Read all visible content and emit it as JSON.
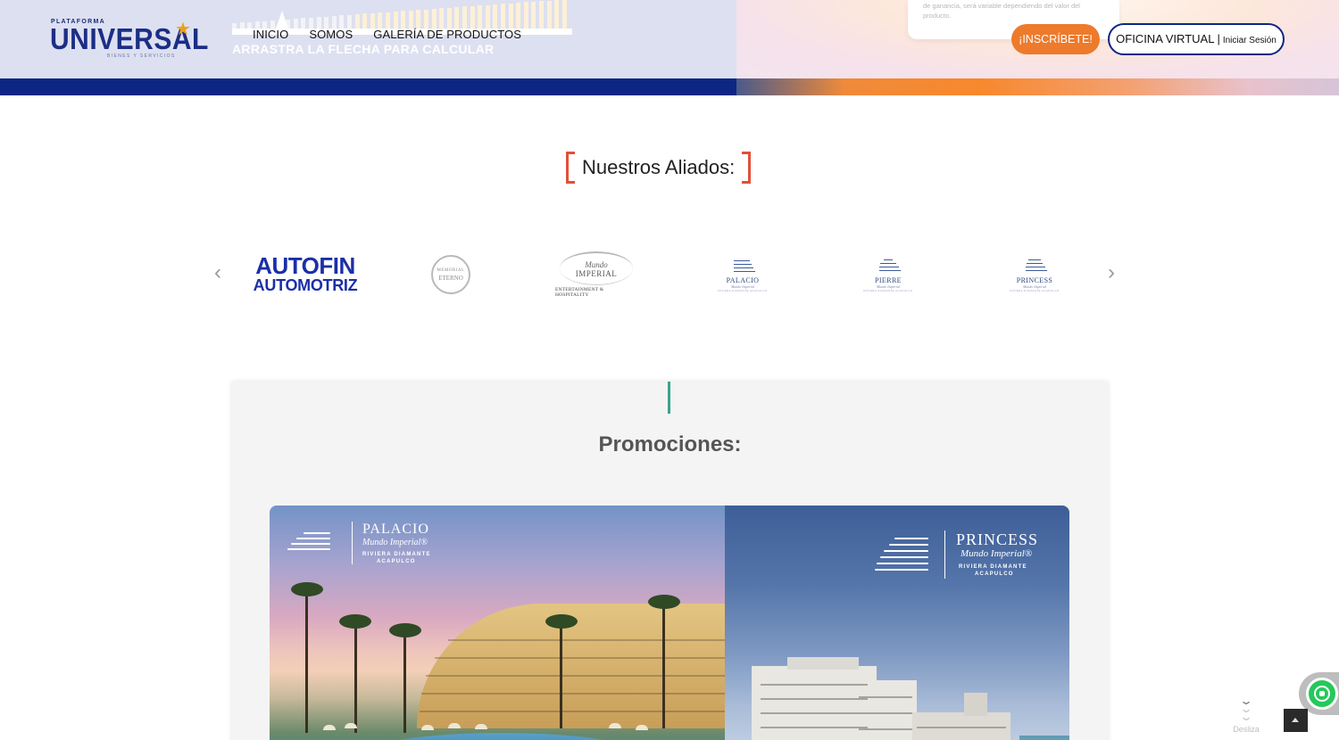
{
  "header": {
    "logo": {
      "top": "PLATAFORMA",
      "main": "UNIVERSAL",
      "sub": "BIENES Y SERVICIOS"
    },
    "nav": [
      "INICIO",
      "SOMOS",
      "GALERÍA DE PRODUCTOS"
    ],
    "calculator_hint": "ARRASTRA LA FLECHA PARA CALCULAR",
    "info_card_text": "de ganancia, será variable dependiendo del valor del producto.",
    "signup_label": "¡INSCRÍBETE!",
    "office_label": "OFICINA VIRTUAL",
    "office_separator": "|",
    "office_login": "Iniciar Sesión",
    "colors": {
      "navy": "#0d2683",
      "orange": "#ee7a2c"
    }
  },
  "allies": {
    "title": "Nuestros Aliados:",
    "prev_glyph": "‹",
    "next_glyph": "›",
    "items": [
      {
        "line1": "AUTOFIN",
        "line2": "AUTOMOTRIZ"
      },
      {
        "line1": "MEMORIAL",
        "line2": "ETERNO"
      },
      {
        "script": "Mundo",
        "name": "IMPERIAL",
        "tagline": "ENTERTAINMENT & HOSPITALITY"
      },
      {
        "name": "PALACIO",
        "script": "Mundo Imperial",
        "tagline": "RIVIERA DIAMANTE ACAPULCO"
      },
      {
        "name": "PIERRE",
        "script": "Mundo Imperial",
        "tagline": "RIVIERA DIAMANTE ACAPULCO"
      },
      {
        "name": "PRINCESS",
        "script": "Mundo Imperial",
        "tagline": "RIVIERA DIAMANTE ACAPULCO"
      }
    ]
  },
  "promotions": {
    "title": "Promociones:",
    "banner_left": {
      "name": "PALACIO",
      "script": "Mundo Imperial®",
      "tagline1": "RIVIERA DIAMANTE",
      "tagline2": "ACAPULCO"
    },
    "banner_right": {
      "name": "PRINCESS",
      "script": "Mundo Imperial®",
      "tagline1": "RIVIERA DIAMANTE",
      "tagline2": "ACAPULCO"
    }
  },
  "widgets": {
    "scroll_label": "Desliza",
    "scroll_glyph": "⌄",
    "whatsapp_icon": "whatsapp-icon",
    "to_top_icon": "caret-up-icon"
  }
}
